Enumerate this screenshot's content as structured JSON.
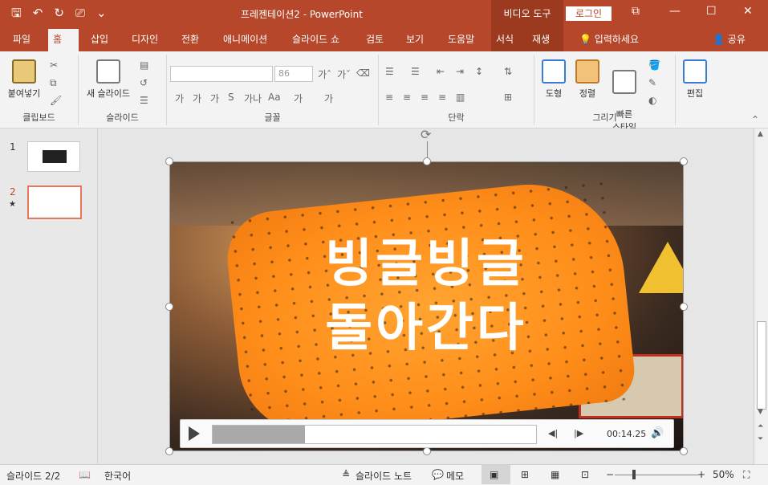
{
  "title_bar": {
    "title": "프레젠테이션2  -  PowerPoint",
    "context_tools": "비디오 도구",
    "login_label": "로그인",
    "qat_icons": [
      "save-icon",
      "undo-icon",
      "redo-icon",
      "present-icon",
      "customize-icon"
    ],
    "qat_glyphs": [
      "🖫",
      "↶",
      "↻",
      "⎚",
      "⌄"
    ],
    "controls": [
      "⧉",
      "—",
      "☐",
      "✕"
    ]
  },
  "tabs": {
    "items": [
      "파일",
      "홈",
      "삽입",
      "디자인",
      "전환",
      "애니메이션",
      "슬라이드 쇼",
      "검토",
      "보기",
      "도움말",
      "서식",
      "재생"
    ],
    "active": "홈",
    "tell_me": "입력하세요",
    "share": "공유"
  },
  "ribbon": {
    "clipboard": {
      "label": "클립보드",
      "paste": "붙여넣기"
    },
    "slides": {
      "label": "슬라이드",
      "new_slide": "새 슬라이드"
    },
    "font": {
      "label": "글꼴",
      "size": "86",
      "format_glyphs": [
        "가",
        "가",
        "가",
        "S",
        "가나",
        "Aa",
        "가",
        "가"
      ]
    },
    "paragraph": {
      "label": "단락"
    },
    "drawing": {
      "label": "그리기",
      "shapes": "도형",
      "arrange": "정렬",
      "quick_styles": "빠른\n스타일"
    },
    "editing": {
      "label": "편집",
      "find": "편집"
    }
  },
  "thumbnails": {
    "items": [
      {
        "num": "1",
        "star": ""
      },
      {
        "num": "2",
        "star": "★"
      }
    ]
  },
  "video": {
    "caption_line1": "빙글빙글",
    "caption_line2": "돌아간다",
    "time": "00:14.25",
    "progress": 0.285
  },
  "status": {
    "slide": "슬라이드 2/2",
    "language": "한국어",
    "notes": "슬라이드 노트",
    "comments": "메모",
    "zoom": "50%"
  }
}
